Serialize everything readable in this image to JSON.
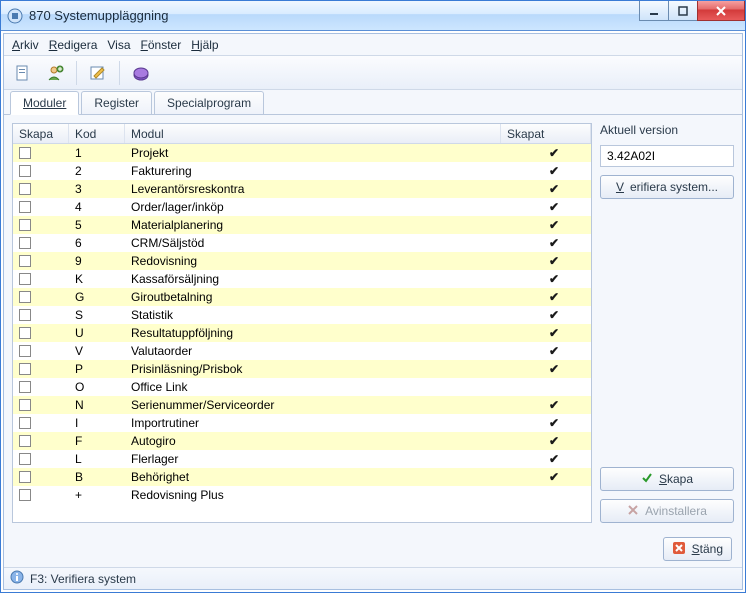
{
  "window": {
    "title": "870 Systemuppläggning"
  },
  "menu": {
    "arkiv": "Arkiv",
    "redigera": "Redigera",
    "visa": "Visa",
    "fonster": "Fönster",
    "hjalp": "Hjälp"
  },
  "tabs": {
    "moduler": "Moduler",
    "register": "Register",
    "special": "Specialprogram"
  },
  "columns": {
    "skapa": "Skapa",
    "kod": "Kod",
    "modul": "Modul",
    "skapat": "Skapat"
  },
  "rows": [
    {
      "kod": "1",
      "modul": "Projekt",
      "skapat": true
    },
    {
      "kod": "2",
      "modul": "Fakturering",
      "skapat": true
    },
    {
      "kod": "3",
      "modul": "Leverantörsreskontra",
      "skapat": true
    },
    {
      "kod": "4",
      "modul": "Order/lager/inköp",
      "skapat": true
    },
    {
      "kod": "5",
      "modul": "Materialplanering",
      "skapat": true
    },
    {
      "kod": "6",
      "modul": "CRM/Säljstöd",
      "skapat": true
    },
    {
      "kod": "9",
      "modul": "Redovisning",
      "skapat": true
    },
    {
      "kod": "K",
      "modul": "Kassaförsäljning",
      "skapat": true
    },
    {
      "kod": "G",
      "modul": "Giroutbetalning",
      "skapat": true
    },
    {
      "kod": "S",
      "modul": "Statistik",
      "skapat": true
    },
    {
      "kod": "U",
      "modul": "Resultatuppföljning",
      "skapat": true
    },
    {
      "kod": "V",
      "modul": "Valutaorder",
      "skapat": true
    },
    {
      "kod": "P",
      "modul": "Prisinläsning/Prisbok",
      "skapat": true
    },
    {
      "kod": "O",
      "modul": "Office Link",
      "skapat": false
    },
    {
      "kod": "N",
      "modul": "Serienummer/Serviceorder",
      "skapat": true
    },
    {
      "kod": "I",
      "modul": "Importrutiner",
      "skapat": true
    },
    {
      "kod": "F",
      "modul": "Autogiro",
      "skapat": true
    },
    {
      "kod": "L",
      "modul": "Flerlager",
      "skapat": true
    },
    {
      "kod": "B",
      "modul": "Behörighet",
      "skapat": true
    },
    {
      "kod": "+",
      "modul": "Redovisning Plus",
      "skapat": false
    }
  ],
  "sidebar": {
    "version_label": "Aktuell version",
    "version_value": "3.42A02I",
    "verify": "Verifiera system...",
    "skapa": "Skapa",
    "avinstallera": "Avinstallera"
  },
  "bottom": {
    "stang": "Stäng"
  },
  "status": {
    "text": "F3: Verifiera system"
  }
}
